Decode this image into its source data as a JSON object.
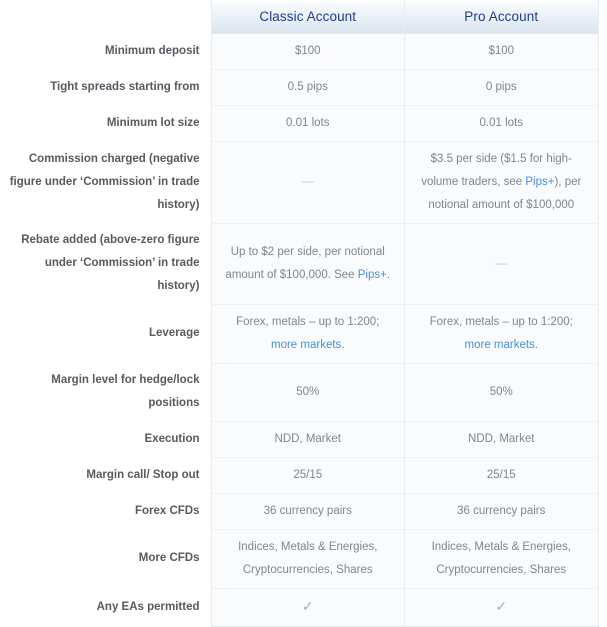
{
  "table": {
    "corner_label": "",
    "columns": [
      {
        "id": "classic",
        "label": "Classic Account"
      },
      {
        "id": "pro",
        "label": "Pro Account"
      }
    ],
    "accent_header_text_color": "#1f3c8c",
    "link_color": "#4a90d9",
    "cell_text_color": "#7f868d",
    "label_text_color": "#555b61",
    "cell_background": "#fafbfc",
    "rows": [
      {
        "label": "Minimum deposit",
        "classic": {
          "text": "$100"
        },
        "pro": {
          "text": "$100"
        }
      },
      {
        "label": "Tight spreads starting from",
        "classic": {
          "text": "0.5 pips"
        },
        "pro": {
          "text": "0 pips"
        }
      },
      {
        "label": "Minimum lot size",
        "classic": {
          "text": "0.01 lots"
        },
        "pro": {
          "text": "0.01 lots"
        }
      },
      {
        "label": "Commission charged (negative figure under ‘Commission’ in trade history)",
        "classic": {
          "text": "—",
          "kind": "dash"
        },
        "pro": {
          "kind": "rich",
          "parts": [
            {
              "text": "$3.5 per side ($1.5 for high-volume traders, see "
            },
            {
              "text": "Pips+",
              "link": true
            },
            {
              "text": "), per notional amount of $100,000"
            }
          ]
        }
      },
      {
        "label": "Rebate added (above-zero figure under ‘Commission’ in trade history)",
        "classic": {
          "kind": "rich",
          "parts": [
            {
              "text": "Up to $2 per side, per notional amount of $100,000. See "
            },
            {
              "text": "Pips+",
              "link": true
            },
            {
              "text": "."
            }
          ]
        },
        "pro": {
          "text": "—",
          "kind": "dash"
        }
      },
      {
        "label": "Leverage",
        "classic": {
          "kind": "rich",
          "parts": [
            {
              "text": "Forex, metals – up to 1:200; "
            },
            {
              "text": "more markets",
              "link": true
            },
            {
              "text": "."
            }
          ]
        },
        "pro": {
          "kind": "rich",
          "parts": [
            {
              "text": "Forex, metals – up to 1:200; "
            },
            {
              "text": "more markets",
              "link": true
            },
            {
              "text": "."
            }
          ]
        }
      },
      {
        "label": "Margin level for hedge/lock positions",
        "classic": {
          "text": "50%"
        },
        "pro": {
          "text": "50%"
        }
      },
      {
        "label": "Execution",
        "classic": {
          "text": "NDD, Market"
        },
        "pro": {
          "text": "NDD, Market"
        }
      },
      {
        "label": "Margin call/ Stop out",
        "classic": {
          "text": "25/15"
        },
        "pro": {
          "text": "25/15"
        }
      },
      {
        "label": "Forex CFDs",
        "classic": {
          "text": "36 currency pairs"
        },
        "pro": {
          "text": "36 currency pairs"
        }
      },
      {
        "label": "More CFDs",
        "classic": {
          "text": "Indices, Metals & Energies, Cryptocurrencies, Shares"
        },
        "pro": {
          "text": "Indices, Metals & Energies, Cryptocurrencies, Shares"
        }
      },
      {
        "label": "Any EAs permitted",
        "classic": {
          "text": "✓",
          "kind": "tick"
        },
        "pro": {
          "text": "✓",
          "kind": "tick"
        }
      }
    ]
  }
}
